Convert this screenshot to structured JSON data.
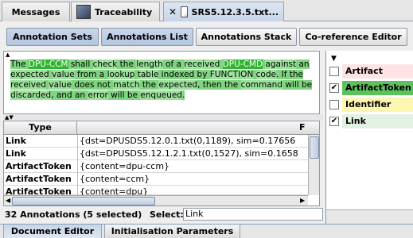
{
  "top_tabs": [
    {
      "label": "Messages"
    },
    {
      "label": "Traceability"
    },
    {
      "label": "SRS5.12.3.5.txt..."
    }
  ],
  "toolbar": {
    "annotation_sets": "Annotation Sets",
    "annotations_list": "Annotations List",
    "annotations_stack": "Annotations Stack",
    "coreference_editor": "Co-reference Editor"
  },
  "text": {
    "segments": [
      "The ",
      "DPU-CCM",
      " shall ",
      "check",
      " the ",
      "length",
      " of a ",
      "received",
      " ",
      "DPU-CMD",
      " ",
      "against",
      " an ",
      "expected",
      " ",
      "value",
      " from a ",
      "lookup",
      " ",
      "table",
      " indexed by ",
      "FUNCTION",
      " ",
      "code",
      ".  If the ",
      "received",
      " ",
      "value",
      " does not ",
      "match",
      " the ",
      "expected",
      ", then the ",
      "command",
      " will be ",
      "discarded",
      ", and an ",
      "error",
      " will be ",
      "enqueued",
      "."
    ]
  },
  "table": {
    "col_type": "Type",
    "col_features": "F",
    "rows": [
      {
        "type": "Link",
        "features": "{dst=DPUSDS5.12.0.1.txt(0,1189), sim=0.17656"
      },
      {
        "type": "Link",
        "features": "{dst=DPUSDS5.12.1.2.1.txt(0,1527), sim=0.1658"
      },
      {
        "type": "ArtifactToken",
        "features": "{content=dpu-ccm}"
      },
      {
        "type": "ArtifactToken",
        "features": "{content=ccm}"
      },
      {
        "type": "ArtifactToken",
        "features": "{content=dpu}"
      }
    ]
  },
  "status": {
    "count": "32 Annotations (5 selected)",
    "select_label": "Select:",
    "select_value": "Link"
  },
  "types": [
    {
      "label": "Artifact",
      "checked": false,
      "color": "#fde3e3"
    },
    {
      "label": "ArtifactToken",
      "checked": true,
      "color": "#5cc25c"
    },
    {
      "label": "Identifier",
      "checked": false,
      "color": "#fdf6b0"
    },
    {
      "label": "Link",
      "checked": true,
      "color": "#e2f2e2"
    }
  ],
  "bottom_tabs": [
    {
      "label": "Document Editor"
    },
    {
      "label": "Initialisation Parameters"
    }
  ]
}
